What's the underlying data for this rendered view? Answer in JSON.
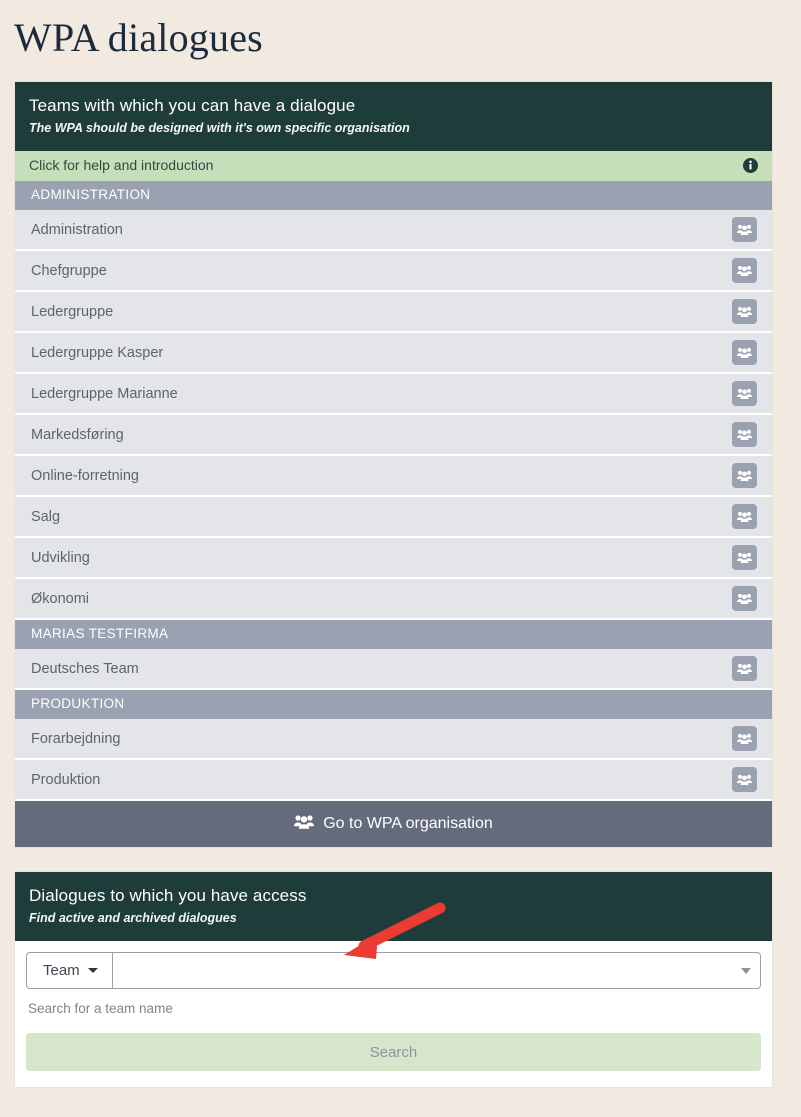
{
  "page": {
    "title": "WPA dialogues",
    "background_color": "#f2eae0"
  },
  "colors": {
    "header_dark": "#1e3d3a",
    "help_green": "#c6dfba",
    "group_gray": "#9aa2b1",
    "row_gray": "#e3e5e9",
    "cta_slate": "#646c7c",
    "search_green": "#d6e6cd",
    "arrow_red": "#ec3b33"
  },
  "teams_card": {
    "title": "Teams with which you can have a dialogue",
    "subtitle": "The WPA should be designed with it's own specific organisation",
    "help_strip": {
      "label": "Click for help and introduction",
      "icon": "info-circle-icon"
    },
    "groups": [
      {
        "name": "ADMINISTRATION",
        "teams": [
          {
            "name": "Administration",
            "action_icon": "users-icon"
          },
          {
            "name": "Chefgruppe",
            "action_icon": "users-icon"
          },
          {
            "name": "Ledergruppe",
            "action_icon": "users-icon"
          },
          {
            "name": "Ledergruppe Kasper",
            "action_icon": "users-icon"
          },
          {
            "name": "Ledergruppe Marianne",
            "action_icon": "users-icon"
          },
          {
            "name": "Markedsføring",
            "action_icon": "users-icon"
          },
          {
            "name": "Online-forretning",
            "action_icon": "users-icon"
          },
          {
            "name": "Salg",
            "action_icon": "users-icon"
          },
          {
            "name": "Udvikling",
            "action_icon": "users-icon"
          },
          {
            "name": "Økonomi",
            "action_icon": "users-icon"
          }
        ]
      },
      {
        "name": "MARIAS TESTFIRMA",
        "teams": [
          {
            "name": "Deutsches Team",
            "action_icon": "users-icon"
          }
        ]
      },
      {
        "name": "PRODUKTION",
        "teams": [
          {
            "name": "Forarbejdning",
            "action_icon": "users-icon"
          },
          {
            "name": "Produktion",
            "action_icon": "users-icon"
          }
        ]
      }
    ],
    "footer_button": {
      "label": "Go to WPA organisation",
      "icon": "users-icon"
    }
  },
  "dialogues_card": {
    "title": "Dialogues to which you have access",
    "subtitle": "Find active and archived dialogues",
    "search": {
      "type_selector_label": "Team",
      "type_selector_icon": "caret-down-icon",
      "input_value": "",
      "input_placeholder": "",
      "input_caret_icon": "caret-down-icon",
      "helper_text": "Search for a team name",
      "submit_label": "Search"
    }
  },
  "annotation": {
    "arrow": "red-arrow-pointing-down-left"
  }
}
